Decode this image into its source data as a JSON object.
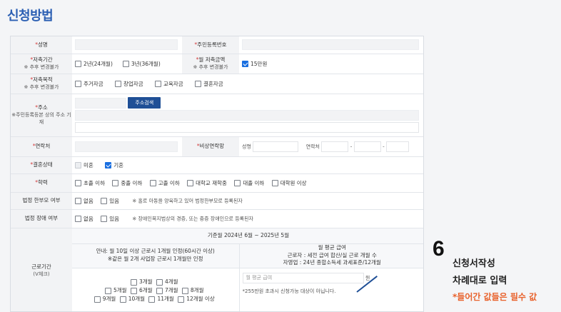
{
  "page_title": "신청방법",
  "fields": {
    "name": {
      "label": "성명"
    },
    "resident_no": {
      "label": "주민등록번호"
    },
    "saving_period": {
      "label": "저축기간",
      "note": "※ 추후 변경불가",
      "options": [
        "2년(24개월)",
        "3년(36개월)"
      ]
    },
    "monthly_amount": {
      "label": "월 저축금액",
      "note": "※ 추후 변경불가",
      "options": [
        "15만원"
      ]
    },
    "purpose": {
      "label": "저축목적",
      "note": "※ 추후 변경불가",
      "options": [
        "주거자금",
        "창업자금",
        "교육자금",
        "결혼자금"
      ]
    },
    "address": {
      "label": "주소",
      "note": "※주민등록등본 상의 주소 기재",
      "button": "주소검색"
    },
    "contact": {
      "label": "연락처"
    },
    "emergency": {
      "label": "비상연락망",
      "name_label": "성명",
      "phone_label": "연락처",
      "phone_dashes": [
        "-",
        "-"
      ]
    },
    "marital": {
      "label": "결혼상태",
      "options": [
        "미혼",
        "기혼"
      ]
    },
    "education": {
      "label": "학력",
      "options": [
        "초졸 이하",
        "중졸 이하",
        "고졸 이하",
        "대학교 재학중",
        "대졸 이하",
        "대학원 이상"
      ]
    },
    "single_parent": {
      "label": "법정 한부모 여부",
      "options": [
        "없음",
        "있음"
      ],
      "hint": "※ 홀로 아동을 양육하고 있어 법정한부모로 등록된자"
    },
    "disability": {
      "label": "법정 장애 여부",
      "options": [
        "없음",
        "있음"
      ],
      "hint": "※ 장애인복지법상의 경증, 또는 중증 장애인으로 등록된자"
    },
    "work_period": {
      "label": "근로기간",
      "note": "(V체크)",
      "base_month": "기준월 2024년 6월 ~ 2025년 5월",
      "guide_line1": "안내: 월 10일 이상 근로시 1개월 인정(60시간 이상)",
      "guide_line2": "※같은 월 2개 사업장 근로시 1개월만 인정",
      "income_title": "월 평균 급여",
      "income_line1": "근로자 : 세전 급여 합산/실 근로 개월 수",
      "income_line2": "자영업 : 24년 종합소득세 과세표준/12개월",
      "income_placeholder": "월 평균 급여",
      "income_unit": "원",
      "income_note": "*255만원 초과시 신청가능 대상이 아닙니다.",
      "month_rows": [
        [
          "3개월",
          "4개월"
        ],
        [
          "5개월",
          "6개월",
          "7개월",
          "8개월"
        ],
        [
          "9개월",
          "10개월",
          "11개월",
          "12개월 이상"
        ]
      ]
    }
  },
  "instruction": {
    "step_number": "6",
    "title": "신청서작성",
    "subtitle": "차례대로 입력",
    "required_note": "*들어간 값들은 필수 값"
  },
  "colors": {
    "title_blue": "#2b5fb3",
    "button_navy": "#1f4f96",
    "checkbox_blue": "#1a6fe0",
    "required_red": "#d23b3b",
    "note_orange": "#e8622c"
  },
  "state": {
    "monthly_amount_checked": "15만원",
    "marital_checked": "기혼"
  }
}
